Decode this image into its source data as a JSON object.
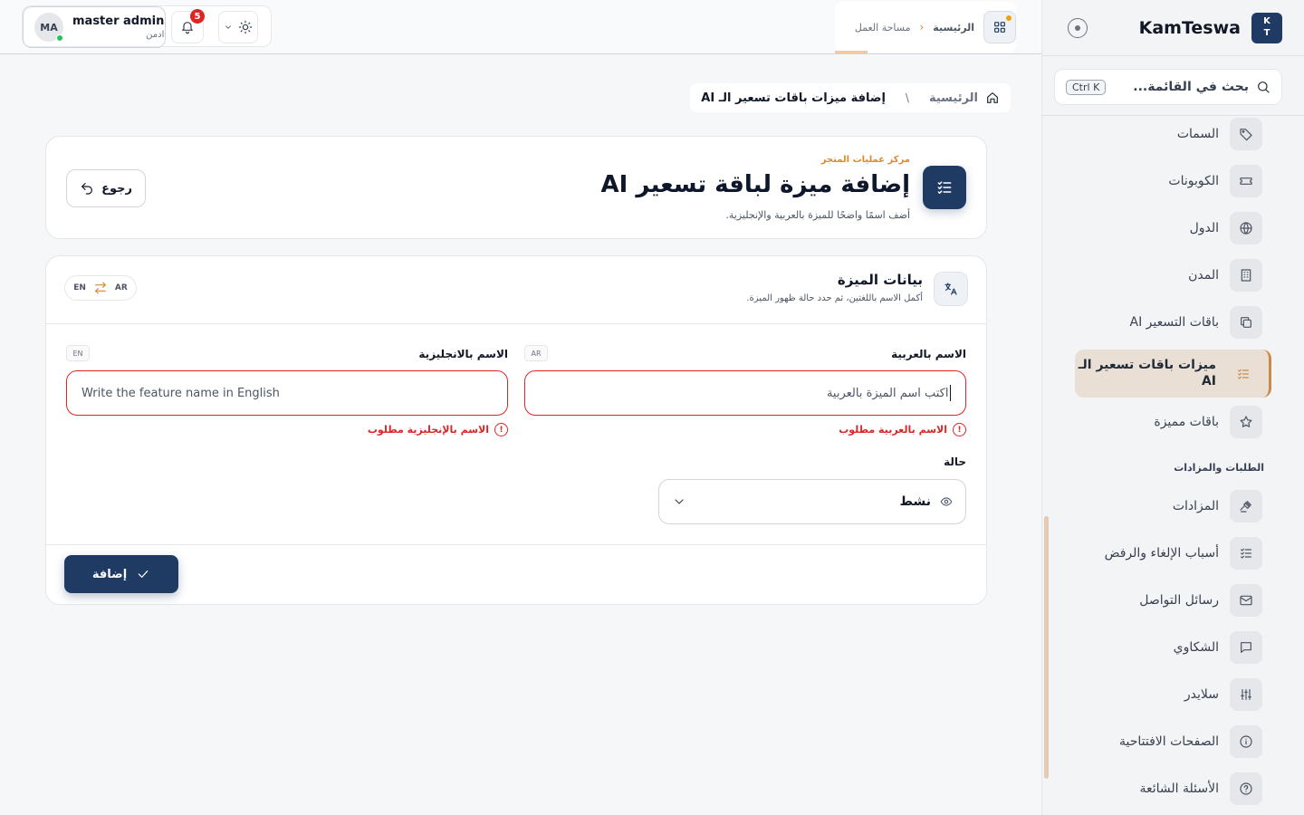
{
  "sidebar": {
    "logo_line1": "K",
    "logo_line2": "T",
    "brand": "KamTeswa",
    "search_placeholder": "بحث في القائمة...",
    "search_shortcut": "Ctrl K",
    "items": [
      {
        "label": "السمات",
        "icon": "tag-icon"
      },
      {
        "label": "الكوبونات",
        "icon": "ticket-icon"
      },
      {
        "label": "الدول",
        "icon": "globe-icon"
      },
      {
        "label": "المدن",
        "icon": "building-icon"
      },
      {
        "label": "باقات التسعير AI",
        "icon": "copy-icon"
      },
      {
        "label": "ميزات باقات تسعير الـ AI",
        "icon": "list-check-icon"
      },
      {
        "label": "باقات مميزة",
        "icon": "star-icon"
      },
      {
        "label": "المزادات",
        "icon": "gavel-icon"
      },
      {
        "label": "أسباب الإلغاء والرفض",
        "icon": "list-check-icon"
      },
      {
        "label": "رسائل التواصل",
        "icon": "mail-icon"
      },
      {
        "label": "الشكاوي",
        "icon": "chat-icon"
      },
      {
        "label": "سلايدر",
        "icon": "sliders-icon"
      },
      {
        "label": "الصفحات الافتتاحية",
        "icon": "info-icon"
      },
      {
        "label": "الأسئلة الشائعة",
        "icon": "help-icon"
      }
    ],
    "section_orders": "الطلبات والمزادات",
    "active_color": "#c98b4a"
  },
  "topbar": {
    "bc_home": "الرئيسية",
    "bc_workspace": "مساحة العمل",
    "user_initials": "MA",
    "user_name": "master admin",
    "user_role": "ادمن",
    "notif_count": "5"
  },
  "page": {
    "bc_home": "الرئيسية",
    "bc_current": "إضافة ميزات باقات تسعير الـ AI",
    "eyebrow": "مركز عمليات المتجر",
    "title": "إضافة ميزة لباقة تسعير AI",
    "subtitle": "أضف اسمًا واضحًا للميزة بالعربية والإنجليزية.",
    "back_label": "رجوع"
  },
  "form": {
    "section_title": "بيانات الميزة",
    "section_sub": "أكمل الاسم باللغتين، ثم حدد حالة ظهور الميزة.",
    "lang_ar": "AR",
    "lang_en": "EN",
    "ar_label": "الاسم بالعربية",
    "ar_tag": "AR",
    "ar_placeholder": "اكتب اسم الميزة بالعربية",
    "ar_error": "الاسم بالعربية مطلوب",
    "en_label": "الاسم بالانجليزية",
    "en_tag": "EN",
    "en_placeholder": "Write the feature name in English",
    "en_error": "الاسم بالإنجليزية مطلوب",
    "status_label": "حالة",
    "status_value": "نشط",
    "submit_label": "إضافة",
    "error_mark": "!"
  },
  "colors": {
    "primary": "#1f3b63",
    "accent": "#e08a2c",
    "error": "#dc2626"
  }
}
